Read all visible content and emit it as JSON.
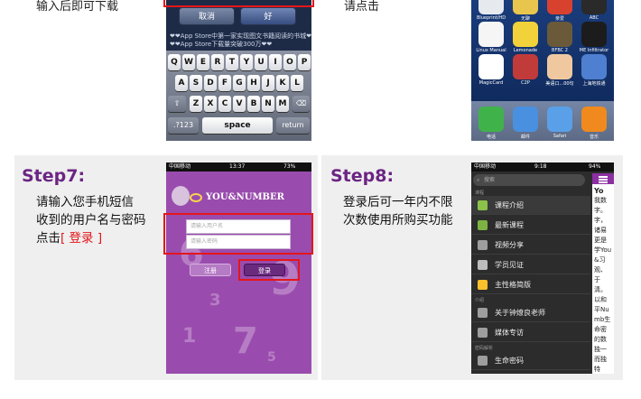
{
  "top": {
    "caption_left": "输入后即可下载",
    "caption_mid": "请点击",
    "alert": {
      "cancel_label": "取消",
      "ok_label": "好",
      "line1": "❤❤App Store中第一家实现图文书籍阅读的书城❤❤",
      "line2": "❤❤App Store下载量突破300万❤❤"
    },
    "keyboard": {
      "row1": [
        "Q",
        "W",
        "E",
        "R",
        "T",
        "Y",
        "U",
        "I",
        "O",
        "P"
      ],
      "row2": [
        "A",
        "S",
        "D",
        "F",
        "G",
        "H",
        "J",
        "K",
        "L"
      ],
      "row3": [
        "Z",
        "X",
        "C",
        "V",
        "B",
        "N",
        "M"
      ],
      "num_key": ".?123",
      "space_key": "space",
      "return_key": "return"
    },
    "home": {
      "labels": [
        "Blueprint/HD",
        "无聊",
        "亲爱",
        "ABC",
        "Linux Manual",
        "Lemonade",
        "BFBC 2",
        "ME Infiltrator",
        "MagicCard",
        "C2P",
        "美语口...00句",
        "上海地铁通"
      ],
      "dock": [
        "电话",
        "邮件",
        "Safari",
        "音乐"
      ]
    }
  },
  "step7": {
    "title": "Step7:",
    "desc_line1": "请输入您手机短信",
    "desc_line2": "收到的用户名与密码",
    "desc_prefix": "点击",
    "desc_action": "[ 登录 ]",
    "status": {
      "carrier": "中国移动",
      "time": "13:37",
      "battery": "73%"
    },
    "brand": "YOU&NUMBER",
    "username_placeholder": "请输入用户名",
    "password_placeholder": "请输入密码",
    "register_label": "注册",
    "login_label": "登录",
    "bg_digits": [
      "6",
      "9",
      "3",
      "1",
      "7",
      "5"
    ]
  },
  "step8": {
    "title": "Step8:",
    "desc_line1": "登录后可一年内不限",
    "desc_line2": "次数使用所购买功能",
    "status": {
      "carrier": "中国移动",
      "time": "9:18",
      "battery": "94%"
    },
    "search_placeholder": "搜索",
    "section_course": "课程",
    "section_intro": "介绍",
    "section_password": "密码解析",
    "items": [
      "课程介绍",
      "最新课程",
      "视频分享",
      "学员见证",
      "主性格简版"
    ],
    "intro_items": [
      "关于钟燎良老师",
      "媒体专访"
    ],
    "password_items": [
      "生命密码"
    ],
    "side_title": "Yo",
    "side_text": "我数字。字，诸易更是学You &习观、于清。以和平Numb生命密的数独一而独特"
  },
  "colors": {
    "step_title": "#6b2583",
    "highlight": "#e4161b",
    "login_bg": "#9a4cae"
  }
}
